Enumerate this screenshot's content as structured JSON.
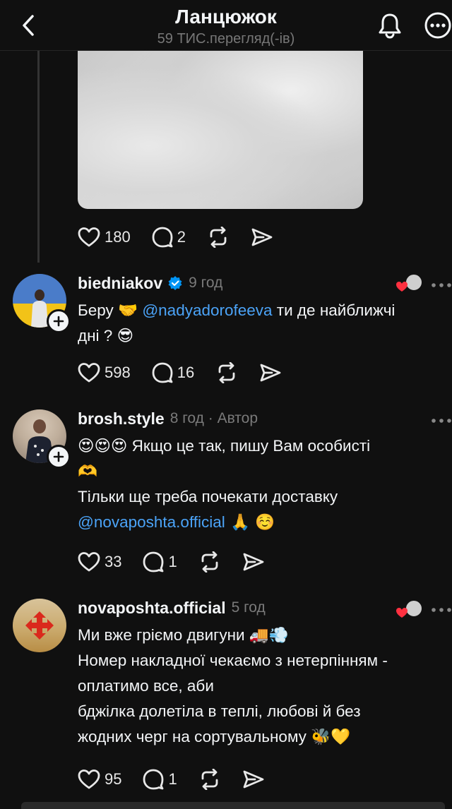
{
  "header": {
    "title": "Ланцюжок",
    "subtitle": "59 ТИС.перегляд(-ів)"
  },
  "top_post": {
    "likes": "180",
    "replies": "2"
  },
  "replies": [
    {
      "username": "biedniakov",
      "verified": true,
      "time": "9 год",
      "text_line1_a": "Беру ",
      "text_line1_emoji": "🤝",
      "text_line1_mention": "@nadyadorofeeva",
      "text_line1_b": " ти де найближчі",
      "text_line2_a": "дні ? ",
      "text_line2_emoji": "😎",
      "likes": "598",
      "replies": "16"
    },
    {
      "username": "brosh.style",
      "time": "8 год · Автор",
      "text_line1_emoji": "😍😍😍",
      "text_line1": " Якщо це так, пишу Вам особисті",
      "text_line2_emoji": "🫶",
      "text_line3": "Тільки ще треба почекати доставку",
      "text_line4_mention": "@novaposhta.official",
      "text_line4_emoji": " 🙏 ☺️",
      "likes": "33",
      "replies": "1"
    },
    {
      "username": "novaposhta.official",
      "time": "5 год",
      "text_line1": "Ми вже гріємо двигуни ",
      "text_line1_emoji": "🚚💨",
      "text_line2": "Номер накладної чекаємо з нетерпінням -",
      "text_line3": "оплатимо все, аби",
      "text_line4": "бджілка долетіла в теплі, любові й без",
      "text_line5": "жодних черг на сортувальному ",
      "text_line5_emoji": "🐝💛",
      "likes": "95",
      "replies": "1"
    }
  ],
  "colors": {
    "background": "#101010",
    "text": "#f3f5f7",
    "muted": "#7a7a7a",
    "mention": "#4ba3f7",
    "verified": "#0095f6",
    "heart": "#ff3040"
  },
  "icons": [
    "back-chevron-icon",
    "bell-icon",
    "more-icon",
    "heart-icon",
    "comment-icon",
    "repost-icon",
    "send-icon",
    "verified-badge-icon",
    "follow-plus-icon",
    "more-dots-icon"
  ]
}
